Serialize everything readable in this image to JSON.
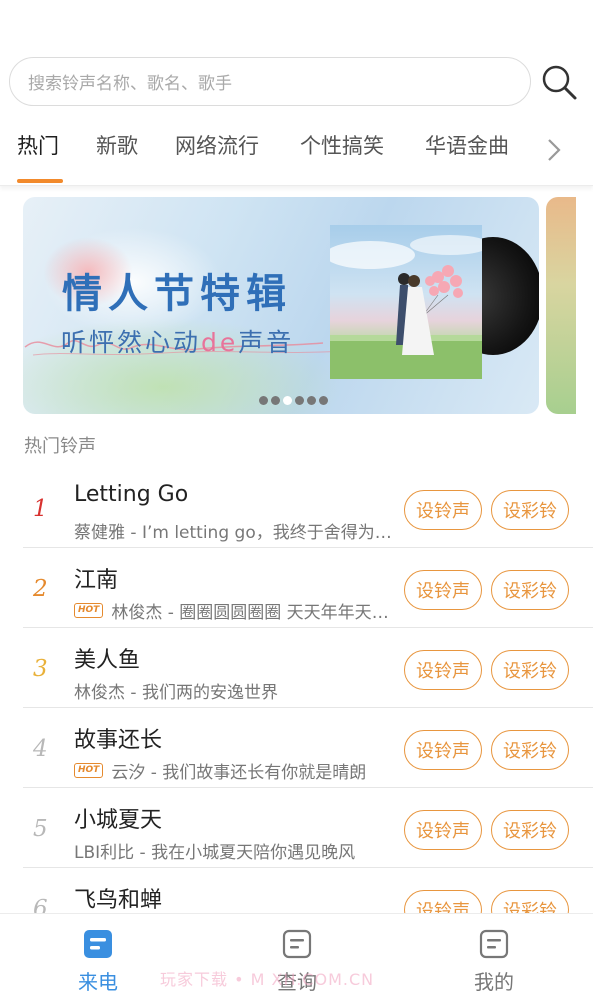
{
  "search": {
    "placeholder": "搜索铃声名称、歌名、歌手",
    "icon": "search-icon"
  },
  "tabs": [
    {
      "label": "热门",
      "active": true
    },
    {
      "label": "新歌",
      "active": false
    },
    {
      "label": "网络流行",
      "active": false
    },
    {
      "label": "个性搞笑",
      "active": false
    },
    {
      "label": "华语金曲",
      "active": false
    }
  ],
  "banner": {
    "title": "情人节特辑",
    "subtitle_prefix": "听怦然心动",
    "subtitle_highlight": "de",
    "subtitle_suffix": "声音",
    "slide_count": 6,
    "active_slide": 3
  },
  "section": {
    "title": "热门铃声"
  },
  "songs": [
    {
      "rank": "1",
      "rank_color": "#d8322f",
      "title": "Letting Go",
      "hot": false,
      "meta": "蔡健雅 - I’m letting go，我终于舍得为你放开手"
    },
    {
      "rank": "2",
      "rank_color": "#e58a2e",
      "title": "江南",
      "hot": true,
      "meta": "林俊杰 - 圈圈圆圆圈圈 天天年年天天的我"
    },
    {
      "rank": "3",
      "rank_color": "#e9b13a",
      "title": "美人鱼",
      "hot": false,
      "meta": "林俊杰 - 我们两的安逸世界"
    },
    {
      "rank": "4",
      "rank_color": "#b8b8b8",
      "title": "故事还长",
      "hot": true,
      "meta": "云汐 - 我们故事还长有你就是晴朗"
    },
    {
      "rank": "5",
      "rank_color": "#b8b8b8",
      "title": "小城夏天",
      "hot": false,
      "meta": "LBI利比 - 我在小城夏天陪你遇见晚风"
    },
    {
      "rank": "6",
      "rank_color": "#b8b8b8",
      "title": "飞鸟和蝉",
      "hot": false,
      "meta": ""
    }
  ],
  "buttons": {
    "set_ringtone": "设铃声",
    "set_color_ring": "设彩铃",
    "hot_badge": "HOT"
  },
  "bottom_nav": [
    {
      "label": "来电",
      "icon": "call-icon",
      "active": true
    },
    {
      "label": "查询",
      "icon": "query-icon",
      "active": false
    },
    {
      "label": "我的",
      "icon": "profile-icon",
      "active": false
    }
  ],
  "watermark": "玩家下载 • M   XH.COM.CN",
  "colors": {
    "accent": "#f28a2c",
    "pill": "#e8963f",
    "nav_active": "#3a8fe0",
    "banner_title": "#2f6fb8"
  }
}
